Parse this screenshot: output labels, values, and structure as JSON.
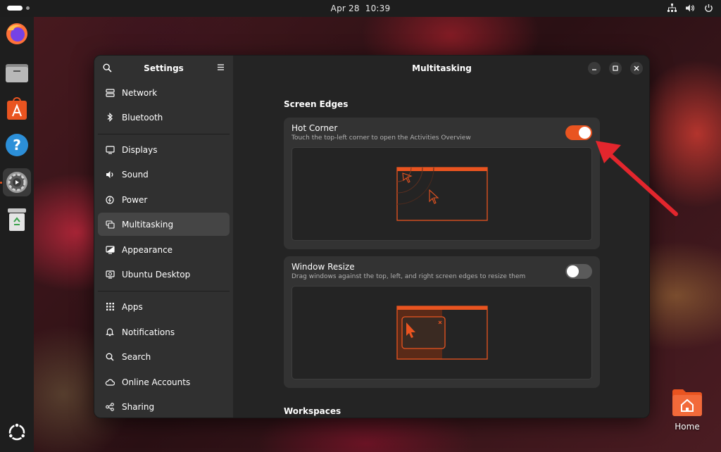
{
  "topbar": {
    "date": "Apr 28",
    "time": "10:39",
    "tray_icons": [
      "network-icon",
      "volume-icon",
      "power-icon"
    ]
  },
  "dock": {
    "apps": [
      {
        "name": "firefox-icon"
      },
      {
        "name": "files-icon"
      },
      {
        "name": "app-center-icon"
      },
      {
        "name": "help-icon"
      },
      {
        "name": "settings-icon",
        "active": true
      },
      {
        "name": "trash-icon"
      }
    ],
    "show_apps": "ubuntu-logo-icon"
  },
  "desktop": {
    "home_label": "Home"
  },
  "settings": {
    "sidebar_title": "Settings",
    "main_title": "Multitasking",
    "nav": [
      {
        "label": "Network",
        "icon": "network-wired-icon"
      },
      {
        "label": "Bluetooth",
        "icon": "bluetooth-icon"
      },
      {
        "label": "Displays",
        "icon": "display-icon"
      },
      {
        "label": "Sound",
        "icon": "speaker-icon"
      },
      {
        "label": "Power",
        "icon": "power-icon"
      },
      {
        "label": "Multitasking",
        "icon": "multitasking-icon",
        "selected": true
      },
      {
        "label": "Appearance",
        "icon": "appearance-icon"
      },
      {
        "label": "Ubuntu Desktop",
        "icon": "ubuntu-desktop-icon"
      },
      {
        "label": "Apps",
        "icon": "apps-grid-icon"
      },
      {
        "label": "Notifications",
        "icon": "bell-icon"
      },
      {
        "label": "Search",
        "icon": "search-icon"
      },
      {
        "label": "Online Accounts",
        "icon": "cloud-icon"
      },
      {
        "label": "Sharing",
        "icon": "share-icon"
      }
    ],
    "sections": {
      "screen_edges": "Screen Edges",
      "workspaces": "Workspaces"
    },
    "hot_corner": {
      "title": "Hot Corner",
      "description": "Touch the top-left corner to open the Activities Overview",
      "enabled": true
    },
    "window_resize": {
      "title": "Window Resize",
      "description": "Drag windows against the top, left, and right screen edges to resize them",
      "enabled": false
    }
  },
  "colors": {
    "accent": "#e95420",
    "annotation": "#e3262d",
    "window_bg": "#242424",
    "sidebar_bg": "#303030",
    "card_bg": "#333333"
  }
}
